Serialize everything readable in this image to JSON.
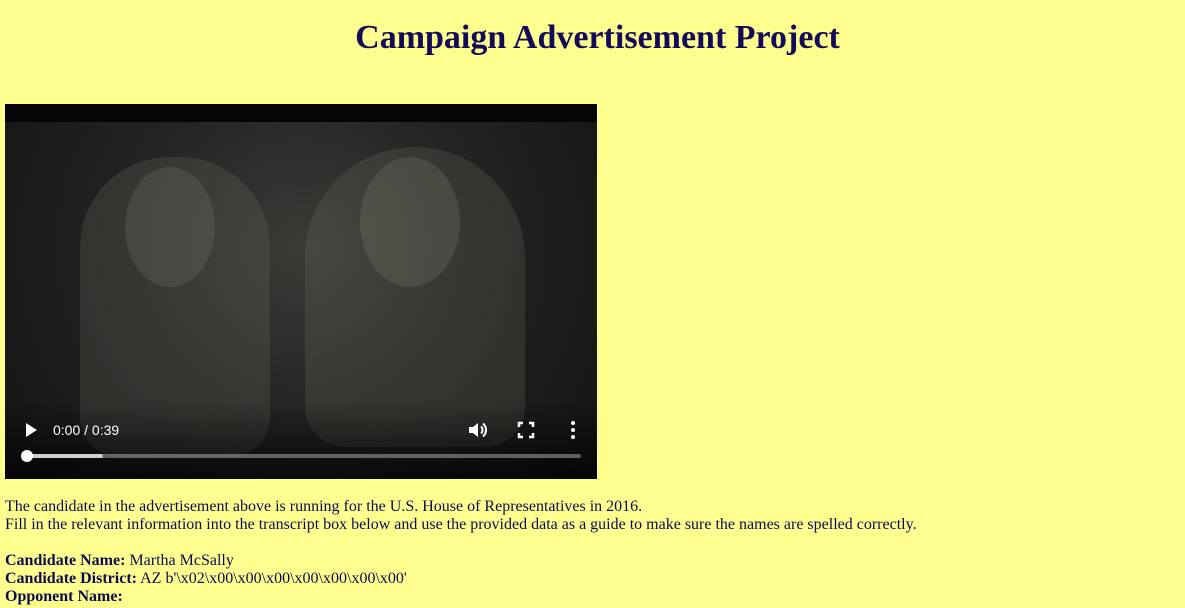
{
  "page": {
    "title": "Campaign Advertisement Project"
  },
  "video": {
    "time": "0:00 / 0:39",
    "progress_fraction": 0,
    "buffered_fraction": 0.14
  },
  "instructions": {
    "line1": "The candidate in the advertisement above is running for the U.S. House of Representatives in 2016.",
    "line2": "Fill in the relevant information into the transcript box below and use the provided data as a guide to make sure the names are spelled correctly."
  },
  "details": {
    "candidate_name_label": "Candidate Name:",
    "candidate_name_value": "Martha McSally",
    "candidate_district_label": "Candidate District:",
    "candidate_district_value": "AZ b'\\x02\\x00\\x00\\x00\\x00\\x00\\x00\\x00'",
    "opponent_name_label": "Opponent Name:"
  },
  "colors": {
    "background": "#ffff8f",
    "text": "#0c0c50",
    "video_background": "#050506"
  },
  "icons": {
    "play": "play-icon",
    "volume": "volume-icon",
    "fullscreen": "fullscreen-icon",
    "more": "more-vertical-icon"
  }
}
